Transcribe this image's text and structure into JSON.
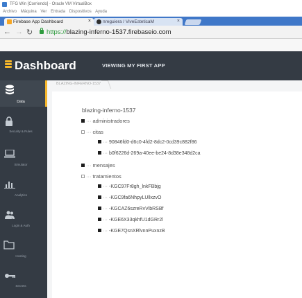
{
  "vbox": {
    "title": "TFG Win [Corriendo] - Oracle VM VirtualBox",
    "menu": [
      "Archivo",
      "Máquina",
      "Ver",
      "Entrada",
      "Dispositivos",
      "Ayuda"
    ]
  },
  "browser": {
    "tabs": [
      {
        "label": "Firebase App Dashboard",
        "close": "×"
      },
      {
        "label": "nreguiera / ViveEsteticaM",
        "close": "×"
      }
    ],
    "url_scheme": "https://",
    "url_host": "blazing-inferno-1537.firebaseio.com"
  },
  "header": {
    "title": "Dashboard",
    "subtitle": "VIEWING MY FIRST APP"
  },
  "sidebar": {
    "items": [
      {
        "label": "Data",
        "icon": "database-icon",
        "active": true
      },
      {
        "label": "Security & Rules",
        "icon": "lock-icon",
        "active": false
      },
      {
        "label": "Simulator",
        "icon": "laptop-icon",
        "active": false
      },
      {
        "label": "Analytics",
        "icon": "bar-chart-icon",
        "active": false
      },
      {
        "label": "Login & Auth",
        "icon": "users-icon",
        "active": false
      },
      {
        "label": "Hosting",
        "icon": "folder-icon",
        "active": false
      },
      {
        "label": "Secrets",
        "icon": "key-icon",
        "active": false
      }
    ]
  },
  "breadcrumb": "BLAZING-INFERNO-1537",
  "tree": {
    "root": "blazing-inferno-1537",
    "nodes": {
      "administradores": "administradores",
      "citas": "citas",
      "citas_1": "90846fd0-d6c0-4fd2-8dc2-0cd39c882f86",
      "citas_2": "b0f6226d-269a-40ee-be24-8d38e348d2ca",
      "mensajes": "mensajes",
      "tratamientos": "tratamientos",
      "trat_1": "-KGC97Fr8gh_lnkFBbjg",
      "trat_2": "-KGC9fa6NhpyLUllxzvO",
      "trat_3": "-KGCAZ6szreRvVibRSBf",
      "trat_4": "-KGE6X33qkhfU1dGRr2l",
      "trat_5": "-KGE7QsnXRlvnnPuxnzB"
    }
  },
  "colors": {
    "header_bg": "#343b44",
    "accent": "#f5b62b",
    "tab_strip": "#3f77c8",
    "secure_green": "#2e9b3e"
  }
}
